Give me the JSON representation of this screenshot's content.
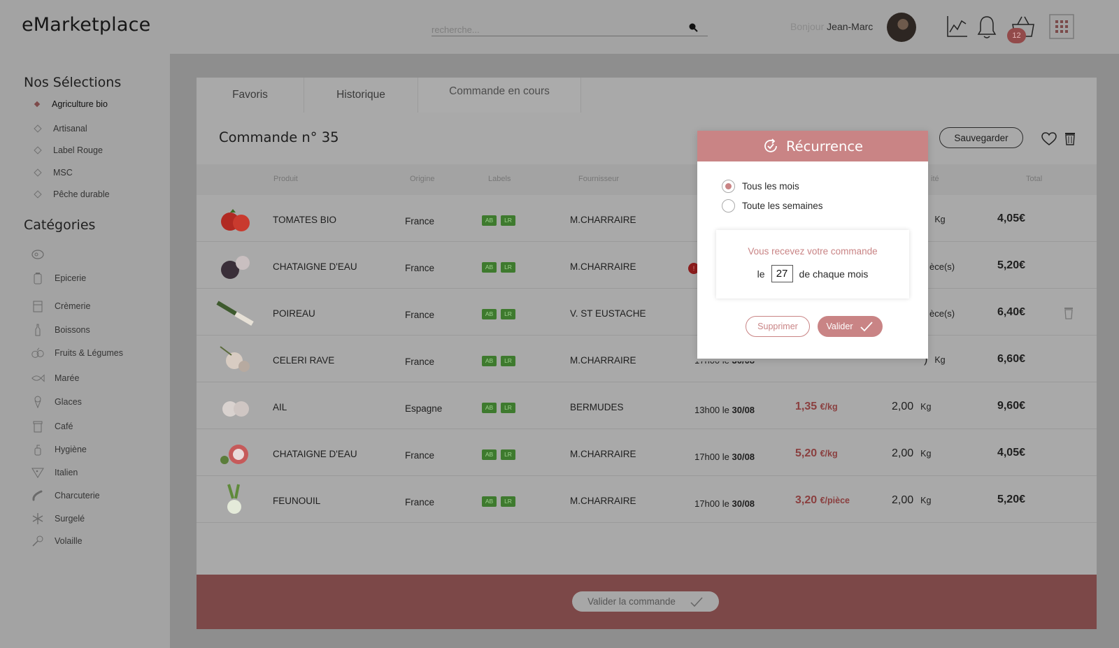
{
  "header": {
    "logo": "eMarketplace",
    "search_placeholder": "recherche...",
    "greeting_prefix": "Bonjour",
    "user_name": "Jean-Marc",
    "cart_count": "12"
  },
  "sidebar": {
    "selections_title": "Nos Sélections",
    "selections": [
      {
        "label": "Agriculture bio",
        "active": true
      },
      {
        "label": "Artisanal"
      },
      {
        "label": "Label Rouge"
      },
      {
        "label": "MSC"
      },
      {
        "label": "Pêche durable"
      }
    ],
    "categories_title": "Catégories",
    "categories": [
      {
        "label": "",
        "icon": "meat-icon"
      },
      {
        "label": "Epicerie",
        "icon": "jar-icon"
      },
      {
        "label": "Crèmerie",
        "icon": "cheese-icon"
      },
      {
        "label": "Boissons",
        "icon": "bottle-icon"
      },
      {
        "label": "Fruits & Légumes",
        "icon": "vegetables-icon"
      },
      {
        "label": "Marée",
        "icon": "fish-icon"
      },
      {
        "label": "Glaces",
        "icon": "ice-cream-icon"
      },
      {
        "label": "Café",
        "icon": "coffee-icon"
      },
      {
        "label": "Hygiène",
        "icon": "soap-icon"
      },
      {
        "label": "Italien",
        "icon": "pizza-icon"
      },
      {
        "label": "Charcuterie",
        "icon": "sausage-icon"
      },
      {
        "label": "Surgelé",
        "icon": "snowflake-icon"
      },
      {
        "label": "Volaille",
        "icon": "drumstick-icon"
      }
    ]
  },
  "tabs": [
    {
      "label": "Favoris"
    },
    {
      "label": "Historique"
    },
    {
      "label": "Commande en cours",
      "active": true
    }
  ],
  "order": {
    "title": "Commande n° 35",
    "save_label": "Sauvegarder",
    "validate_label": "Valider la commande"
  },
  "table": {
    "headers": {
      "product": "Produit",
      "origin": "Origine",
      "labels": "Labels",
      "supplier": "Fournisseur",
      "quantity": "ité",
      "total": "Total"
    },
    "rows": [
      {
        "product": "TOMATES BIO",
        "origin": "France",
        "labels": [
          "AB",
          "LR"
        ],
        "supplier": "M.CHARRAIRE",
        "delivery_time": "",
        "delivery_date": "",
        "unit_price": "",
        "unit": "",
        "qty": ")",
        "qty_unit": "Kg",
        "total": "4,05€"
      },
      {
        "product": "CHATAIGNE D'EAU",
        "origin": "France",
        "labels": [
          "AB",
          "LR"
        ],
        "supplier": "M.CHARRAIRE",
        "alert": "!",
        "delivery_time": "",
        "delivery_date": "",
        "unit_price": "",
        "unit": "",
        "qty": "",
        "qty_unit": "èce(s)",
        "total": "5,20€"
      },
      {
        "product": "POIREAU",
        "origin": "France",
        "labels": [
          "AB",
          "LR"
        ],
        "supplier": "V. ST EUSTACHE",
        "delivery_time": "",
        "delivery_date": "",
        "unit_price": "",
        "unit": "",
        "qty": "",
        "qty_unit": "èce(s)",
        "total": "6,40€"
      },
      {
        "product": "CELERI RAVE",
        "origin": "France",
        "labels": [
          "AB",
          "LR"
        ],
        "supplier": "M.CHARRAIRE",
        "delivery_time": "17h00 le ",
        "delivery_date": "30/08",
        "unit_price": "",
        "unit": "",
        "qty": ")",
        "qty_unit": "Kg",
        "total": "6,60€"
      },
      {
        "product": "AIL",
        "origin": "Espagne",
        "labels": [
          "AB",
          "LR"
        ],
        "supplier": "BERMUDES",
        "delivery_time": "13h00 le ",
        "delivery_date": "30/08",
        "unit_price": "1,35",
        "unit": "€/kg",
        "qty": "2,00",
        "qty_unit": "Kg",
        "total": "9,60€"
      },
      {
        "product": "CHATAIGNE D'EAU",
        "origin": "France",
        "labels": [
          "AB",
          "LR"
        ],
        "supplier": "M.CHARRAIRE",
        "delivery_time": "17h00 le ",
        "delivery_date": "30/08",
        "unit_price": "5,20",
        "unit": "€/kg",
        "qty": "2,00",
        "qty_unit": "Kg",
        "total": "4,05€"
      },
      {
        "product": "FEUNOUIL",
        "origin": "France",
        "labels": [
          "AB",
          "LR"
        ],
        "supplier": "M.CHARRAIRE",
        "delivery_time": "17h00 le ",
        "delivery_date": "30/08",
        "unit_price": "3,20",
        "unit": "€/pièce",
        "qty": "2,00",
        "qty_unit": "Kg",
        "total": "5,20€"
      }
    ]
  },
  "modal": {
    "title": "Récurrence",
    "option_monthly": "Tous les mois",
    "option_weekly": "Toute les semaines",
    "receive_msg": "Vous recevez votre commande",
    "day_prefix": "le",
    "day_value": "27",
    "day_suffix": "de chaque mois",
    "delete_label": "Supprimer",
    "validate_label": "Valider"
  },
  "colors": {
    "accent": "#c98485",
    "bottom_bar": "#7c4848",
    "label_green": "#3e7a2e",
    "price_red": "#8a3f3f"
  }
}
